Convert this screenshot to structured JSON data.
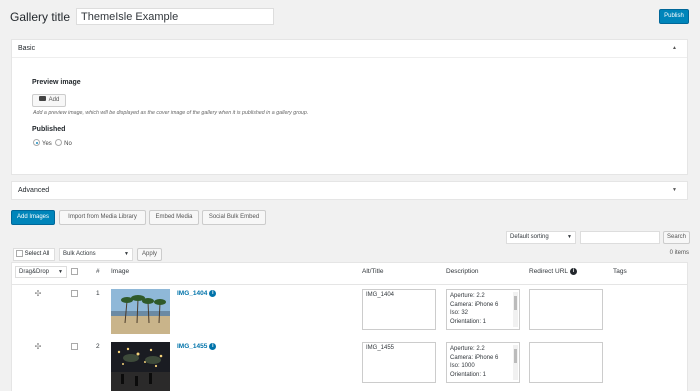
{
  "header": {
    "title_label": "Gallery title",
    "title_value": "ThemeIsle Example",
    "publish_label": "Publish"
  },
  "basic": {
    "heading": "Basic",
    "preview_label": "Preview image",
    "add_label": "Add",
    "hint": "Add a preview image, which will be displayed as the cover image of the gallery when it is published in a gallery group.",
    "published_label": "Published",
    "yes": "Yes",
    "no": "No",
    "published_selected": "Yes"
  },
  "advanced": {
    "heading": "Advanced"
  },
  "toolbar": {
    "add_images": "Add Images",
    "import_media": "Import from Media Library",
    "embed_media": "Embed Media",
    "social_embed": "Social Bulk Embed"
  },
  "sorting": {
    "value": "Default sorting",
    "search_label": "Search",
    "search_placeholder": ""
  },
  "bulk": {
    "select_all": "Select All",
    "bulk_actions": "Bulk Actions",
    "apply": "Apply"
  },
  "items_count": "0 items",
  "table": {
    "headers": {
      "drag": "Drag&Drop",
      "num": "#",
      "image": "Image",
      "alt": "Alt/Title",
      "description": "Description",
      "redirect": "Redirect URL",
      "tags": "Tags"
    },
    "rows": [
      {
        "num": "1",
        "name": "IMG_1404",
        "alt": "IMG_1404",
        "desc": [
          "Aperture: 2.2",
          "Camera: iPhone 6",
          "Iso: 32",
          "Orientation: 1"
        ],
        "redirect": ""
      },
      {
        "num": "2",
        "name": "IMG_1455",
        "alt": "IMG_1455",
        "desc": [
          "Aperture: 2.2",
          "Camera: iPhone 6",
          "Iso: 1000",
          "Orientation: 1"
        ],
        "redirect": ""
      }
    ]
  },
  "colors": {
    "primary": "#0085ba",
    "link": "#0073aa",
    "background": "#f1f1f1"
  }
}
